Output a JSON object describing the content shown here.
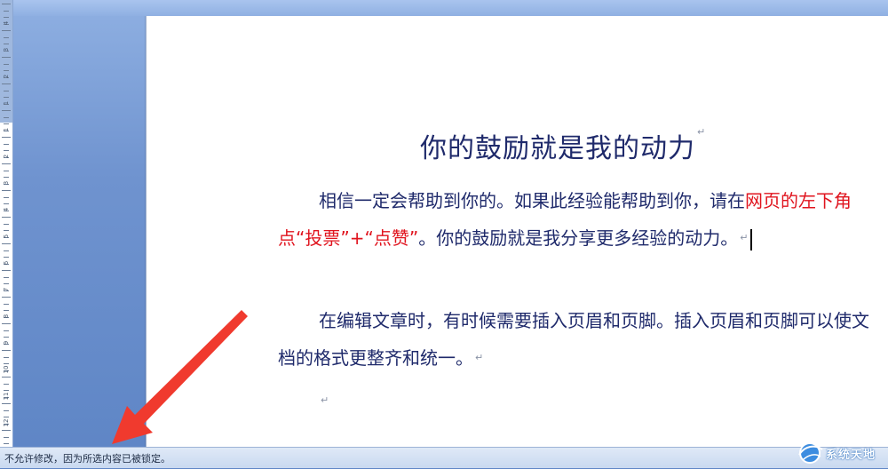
{
  "document": {
    "title": "你的鼓励就是我的动力",
    "paragraphs": [
      {
        "segments": [
          {
            "text": "相信一定会帮助到你的。如果此经验能帮助到你，请在",
            "color": "#1f2a6b"
          },
          {
            "text": "网页的左下角点“投票”+“点赞”",
            "color": "#e0141e"
          },
          {
            "text": "。你的鼓励就是我分享更多经验的动力。",
            "color": "#1f2a6b"
          }
        ]
      },
      {
        "segments": [
          {
            "text": "在编辑文章时，有时候需要插入页眉和页脚。插入页眉和页脚可以使文档的格式更整齐和统一。",
            "color": "#1f2a6b"
          }
        ]
      }
    ],
    "paragraph_mark": "↵"
  },
  "ruler": {
    "labels": [
      "4",
      "3",
      "2",
      "1",
      "1",
      "2",
      "3",
      "4",
      "5",
      "6",
      "7",
      "8",
      "9",
      "10",
      "11",
      "12"
    ]
  },
  "statusbar": {
    "message": "不允许修改，因为所选内容已被锁定。"
  },
  "watermark": {
    "text": "系统天地"
  },
  "colors": {
    "text": "#1f2a6b",
    "highlight": "#e0141e",
    "arrow": "#f03a2e"
  }
}
